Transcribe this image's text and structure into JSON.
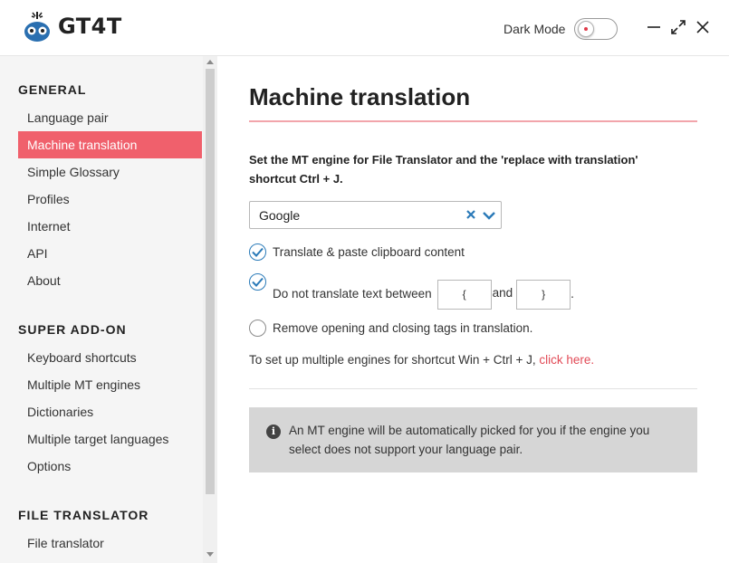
{
  "app": {
    "name": "GT4T"
  },
  "header": {
    "dark_mode_label": "Dark Mode",
    "dark_mode_on": false
  },
  "sidebar": {
    "sections": [
      {
        "title": "GENERAL",
        "items": [
          "Language pair",
          "Machine translation",
          "Simple Glossary",
          "Profiles",
          "Internet",
          "API",
          "About"
        ]
      },
      {
        "title": "SUPER ADD-ON",
        "items": [
          "Keyboard shortcuts",
          "Multiple MT engines",
          "Dictionaries",
          "Multiple target languages",
          "Options"
        ]
      },
      {
        "title": "FILE TRANSLATOR",
        "items": [
          "File translator"
        ]
      }
    ],
    "active_item": "Machine translation"
  },
  "main": {
    "title": "Machine translation",
    "description": "Set the MT engine for File Translator and the 'replace with translation' shortcut Ctrl + J.",
    "engine_select": {
      "value": "Google"
    },
    "options": {
      "translate_paste": {
        "label": "Translate & paste clipboard content",
        "checked": true
      },
      "do_not_translate": {
        "label_before": "Do not translate text between",
        "open_value": "{",
        "label_and": "and",
        "close_value": "}",
        "trailing": ".",
        "checked": true
      },
      "remove_tags": {
        "label": "Remove opening and closing tags in translation.",
        "checked": false
      }
    },
    "multi_engine_note": {
      "text": "To set up multiple engines for shortcut Win + Ctrl + J,",
      "link": "click here."
    },
    "info": "An MT engine will be automatically picked for you if the engine you select does not support your language pair."
  },
  "colors": {
    "accent": "#f0606c",
    "link": "#e24b57",
    "check": "#2a7ab8"
  }
}
